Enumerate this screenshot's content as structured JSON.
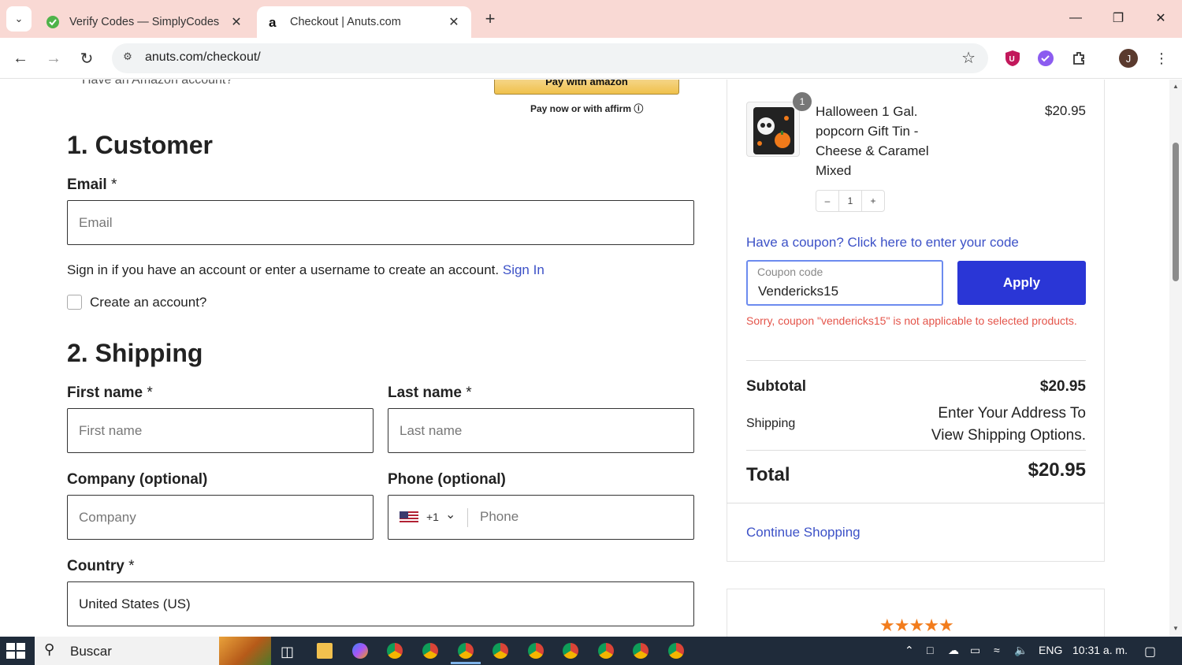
{
  "browser": {
    "tabs": [
      {
        "title": "Verify Codes — SimplyCodes",
        "active": false
      },
      {
        "title": "Checkout | Anuts.com",
        "active": true
      }
    ],
    "url": "anuts.com/checkout/",
    "profile_initial": "J"
  },
  "express": {
    "amazon_prompt": "Have an Amazon account?",
    "amazon_button": "Pay with amazon",
    "affirm_text": "Pay now or with affirm"
  },
  "customer": {
    "heading": "1. Customer",
    "email_label": "Email",
    "required_mark": "*",
    "email_placeholder": "Email",
    "signin_text": "Sign in if you have an account or enter a username to create an account.",
    "signin_link": "Sign In",
    "create_account_label": "Create an account?"
  },
  "shipping": {
    "heading": "2. Shipping",
    "first_name_label": "First name",
    "first_name_placeholder": "First name",
    "last_name_label": "Last name",
    "last_name_placeholder": "Last name",
    "company_label": "Company (optional)",
    "company_placeholder": "Company",
    "phone_label": "Phone (optional)",
    "phone_country_code": "+1",
    "phone_placeholder": "Phone",
    "country_label": "Country",
    "country_value": "United States (US)"
  },
  "cart": {
    "item": {
      "name": "Halloween 1 Gal. popcorn Gift Tin - Cheese & Caramel Mixed",
      "price": "$20.95",
      "quantity": "1",
      "badge": "1"
    },
    "coupon_link": "Have a coupon? Click here to enter your code",
    "coupon_placeholder": "Coupon code",
    "coupon_value": "Vendericks15",
    "apply_button": "Apply",
    "coupon_error": "Sorry, coupon \"vendericks15\" is not applicable to selected products.",
    "subtotal_label": "Subtotal",
    "subtotal_value": "$20.95",
    "shipping_label": "Shipping",
    "shipping_value": "Enter Your Address To View Shipping Options.",
    "total_label": "Total",
    "total_value": "$20.95",
    "continue_link": "Continue Shopping",
    "rating_stars": 5
  },
  "taskbar": {
    "search_text": "Buscar",
    "language": "ENG",
    "time": "10:31 a. m."
  },
  "colors": {
    "accent_blue": "#2a36d6",
    "link_blue": "#3c51c7",
    "error_red": "#e4544a",
    "tab_strip": "#f9d9d4"
  }
}
